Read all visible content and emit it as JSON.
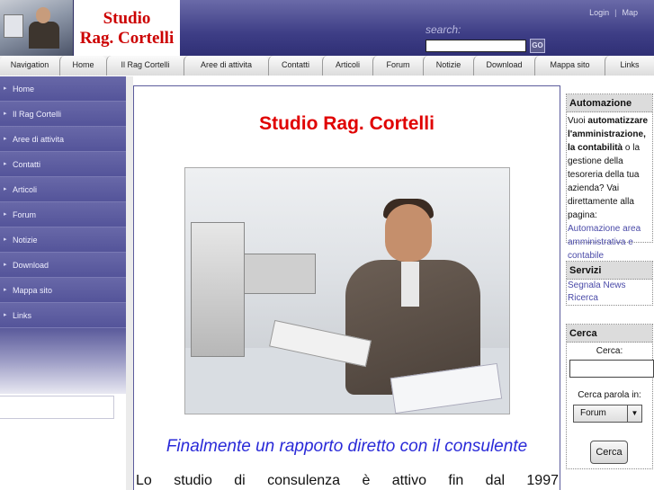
{
  "header": {
    "logo_line1": "Studio",
    "logo_line2": "Rag. Cortelli",
    "login_link": "Login",
    "map_link": "Map",
    "search_label": "search:",
    "search_value": "",
    "search_button": "GO"
  },
  "navbar": {
    "tabs": [
      "Navigation",
      "Home",
      "Il Rag Cortelli",
      "Aree di attivita",
      "Contatti",
      "Articoli",
      "Forum",
      "Notizie",
      "Download",
      "Mappa sito",
      "Links"
    ]
  },
  "sidebar": {
    "items": [
      "Home",
      "Il Rag Cortelli",
      "Aree di attivita",
      "Contatti",
      "Articoli",
      "Forum",
      "Notizie",
      "Download",
      "Mappa sito",
      "Links"
    ]
  },
  "main": {
    "title": "Studio Rag.  Cortelli",
    "subtitle": "Finalmente un rapporto diretto con il consulente",
    "paragraph": "Lo studio di consulenza è attivo fin dal 1997"
  },
  "right": {
    "automazione": {
      "title": "Automazione",
      "t1": "Vuoi ",
      "b1": "automatizzare l'amministrazione, la contabilità",
      "t2": " o la gestione della tesoreria della tua azienda? Vai direttamente alla pagina: ",
      "link": "Automazione area amministrativa e contabile"
    },
    "servizi": {
      "title": "Servizi",
      "links": [
        "Segnala News",
        "Ricerca"
      ]
    },
    "cerca": {
      "title": "Cerca",
      "label": "Cerca:",
      "input_value": "",
      "parola_label": "Cerca parola in:",
      "select_value": "Forum",
      "button": "Cerca"
    }
  }
}
